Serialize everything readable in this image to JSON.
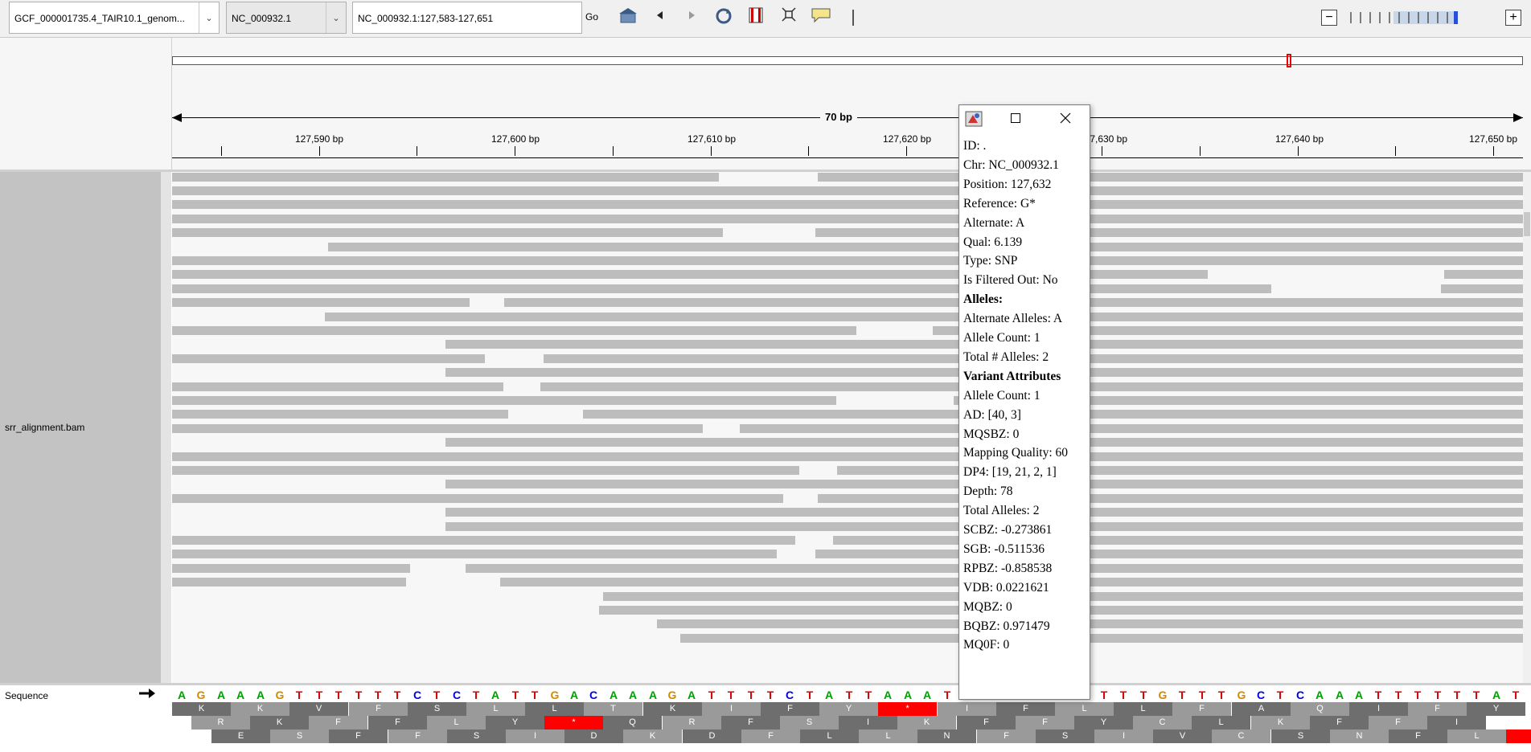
{
  "toolbar": {
    "genome": "GCF_000001735.4_TAIR10.1_genom...",
    "chromosome": "NC_000932.1",
    "locus": "NC_000932.1:127,583-127,651",
    "go_label": "Go"
  },
  "ruler": {
    "span_label": "70 bp",
    "ticks": [
      "127,590 bp",
      "127,600 bp",
      "127,610 bp",
      "127,620 bp",
      "127,630 bp",
      "127,640 bp",
      "127,650 bp"
    ]
  },
  "track": {
    "name": "srr_alignment.bam"
  },
  "sequence": {
    "label": "Sequence",
    "bases": "AGAAAGTTTTTTCTCTATTGACAAAGATTTTCTATTAAATTTTTTTTTTTGTTTGCTCAAATTTTTTATA",
    "frame1": [
      "K",
      "K",
      "V",
      "F",
      "S",
      "L",
      "L",
      "T",
      "K",
      "I",
      "F",
      "Y",
      "*",
      "I",
      "F",
      "L",
      "L",
      "F",
      "A",
      "Q",
      "I",
      "F",
      "Y"
    ],
    "frame2": [
      "R",
      "K",
      "F",
      "F",
      "L",
      "Y",
      "*",
      "Q",
      "R",
      "F",
      "S",
      "I",
      "K",
      "F",
      "F",
      "Y",
      "C",
      "L",
      "K",
      "F",
      "F",
      "I"
    ],
    "frame3": [
      "E",
      "S",
      "F",
      "F",
      "S",
      "I",
      "D",
      "K",
      "D",
      "F",
      "L",
      "L",
      "N",
      "F",
      "S",
      "I",
      "V",
      "C",
      "S",
      "N",
      "F",
      "L",
      "*"
    ]
  },
  "mismatches": [
    "A",
    "A",
    "A",
    "A",
    "A",
    "A",
    "T"
  ],
  "popup": {
    "lines": [
      {
        "text": "ID: .",
        "bold": false
      },
      {
        "text": "Chr: NC_000932.1",
        "bold": false
      },
      {
        "text": "Position: 127,632",
        "bold": false
      },
      {
        "text": "Reference: G*",
        "bold": false
      },
      {
        "text": "Alternate: A",
        "bold": false
      },
      {
        "text": "Qual: 6.139",
        "bold": false
      },
      {
        "text": "Type: SNP",
        "bold": false
      },
      {
        "text": "Is Filtered Out: No",
        "bold": false
      },
      {
        "text": "Alleles:",
        "bold": true
      },
      {
        "text": "Alternate Alleles: A",
        "bold": false
      },
      {
        "text": "Allele Count: 1",
        "bold": false
      },
      {
        "text": "Total # Alleles: 2",
        "bold": false
      },
      {
        "text": "Variant Attributes",
        "bold": true
      },
      {
        "text": "Allele Count: 1",
        "bold": false
      },
      {
        "text": "AD: [40, 3]",
        "bold": false
      },
      {
        "text": "MQSBZ: 0",
        "bold": false
      },
      {
        "text": "Mapping Quality: 60",
        "bold": false
      },
      {
        "text": "DP4: [19, 21, 2, 1]",
        "bold": false
      },
      {
        "text": "Depth: 78",
        "bold": false
      },
      {
        "text": "Total Alleles: 2",
        "bold": false
      },
      {
        "text": "SCBZ: -0.273861",
        "bold": false
      },
      {
        "text": "SGB: -0.511536",
        "bold": false
      },
      {
        "text": "RPBZ: -0.858538",
        "bold": false
      },
      {
        "text": "VDB: 0.0221621",
        "bold": false
      },
      {
        "text": "MQBZ: 0",
        "bold": false
      },
      {
        "text": "BQBZ: 0.971479",
        "bold": false
      },
      {
        "text": "MQ0F: 0",
        "bold": false
      }
    ]
  },
  "colors": {
    "A": "#00a000",
    "C": "#0000e0",
    "G": "#d18a00",
    "T": "#e00000",
    "read": "#bdbdbd",
    "stop": "#ff0000",
    "aa_dark": "#6e6e6e",
    "aa_light": "#9a9a9a"
  }
}
